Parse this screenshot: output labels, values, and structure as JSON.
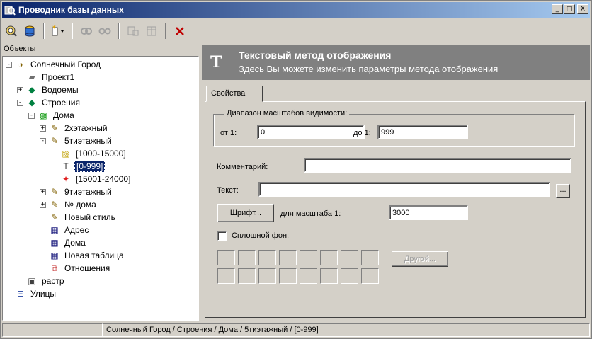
{
  "window": {
    "title": "Проводник базы данных",
    "buttons": [
      "_",
      "□",
      "X"
    ]
  },
  "toolbar": {
    "icons": [
      "database-find-icon",
      "database-open-icon",
      "new-item-icon",
      "link-icon",
      "unlink-icon",
      "properties-icon",
      "table-icon",
      "delete-icon"
    ]
  },
  "tree": {
    "header": "Объекты",
    "items": [
      {
        "label": "Солнечный Город",
        "level": 0,
        "expander": "−",
        "icon": "planet-icon",
        "iconChar": "◑",
        "iconColor": "#806000"
      },
      {
        "label": "Проект1",
        "level": 1,
        "expander": "",
        "icon": "project-icon",
        "iconChar": "▰",
        "iconColor": "#707070"
      },
      {
        "label": "Водоемы",
        "level": 1,
        "expander": "+",
        "icon": "layer-group-icon",
        "iconChar": "◆",
        "iconColor": "#008040"
      },
      {
        "label": "Строения",
        "level": 1,
        "expander": "−",
        "icon": "layer-group-icon",
        "iconChar": "◆",
        "iconColor": "#008040"
      },
      {
        "label": "Дома",
        "level": 2,
        "expander": "−",
        "icon": "layer-icon",
        "iconChar": "▩",
        "iconColor": "#20a020"
      },
      {
        "label": "2хэтажный",
        "level": 3,
        "expander": "+",
        "icon": "style-pencil-icon",
        "iconChar": "✎",
        "iconColor": "#806000"
      },
      {
        "label": "5тиэтажный",
        "level": 3,
        "expander": "−",
        "icon": "style-pencil-icon",
        "iconChar": "✎",
        "iconColor": "#806000"
      },
      {
        "label": "[1000-15000]",
        "level": 4,
        "expander": "",
        "icon": "hatch-method-icon",
        "iconChar": "▨",
        "iconColor": "#c0a000"
      },
      {
        "label": "[0-999]",
        "level": 4,
        "expander": "",
        "icon": "text-method-icon",
        "iconChar": "T",
        "iconColor": "#404040",
        "selected": true
      },
      {
        "label": "[15001-24000]",
        "level": 4,
        "expander": "",
        "icon": "symbol-method-icon",
        "iconChar": "✦",
        "iconColor": "#e02020"
      },
      {
        "label": "9тиэтажный",
        "level": 3,
        "expander": "+",
        "icon": "style-pencil-icon",
        "iconChar": "✎",
        "iconColor": "#806000"
      },
      {
        "label": "№ дома",
        "level": 3,
        "expander": "+",
        "icon": "style-pencil-icon",
        "iconChar": "✎",
        "iconColor": "#806000"
      },
      {
        "label": "Новый стиль",
        "level": 3,
        "expander": "",
        "icon": "style-pencil-icon",
        "iconChar": "✎",
        "iconColor": "#806000"
      },
      {
        "label": "Адрес",
        "level": 3,
        "expander": "",
        "icon": "table-icon",
        "iconChar": "▦",
        "iconColor": "#202080"
      },
      {
        "label": "Дома",
        "level": 3,
        "expander": "",
        "icon": "table-icon",
        "iconChar": "▦",
        "iconColor": "#202080"
      },
      {
        "label": "Новая таблица",
        "level": 3,
        "expander": "",
        "icon": "table-icon",
        "iconChar": "▦",
        "iconColor": "#202080"
      },
      {
        "label": "Отношения",
        "level": 3,
        "expander": "",
        "icon": "relations-icon",
        "iconChar": "⧉",
        "iconColor": "#c02020"
      },
      {
        "label": "растр",
        "level": 1,
        "expander": "",
        "icon": "raster-icon",
        "iconChar": "▣",
        "iconColor": "#404040"
      },
      {
        "label": "Улицы",
        "level": 0,
        "expander": "",
        "icon": "streets-icon",
        "iconChar": "⊟",
        "iconColor": "#2040a0"
      }
    ]
  },
  "header": {
    "icon": "T",
    "title": "Текстовый метод отображения",
    "subtitle": "Здесь Вы можете изменить параметры метода отображения"
  },
  "tab": {
    "label": "Свойства"
  },
  "visibility": {
    "group_title": "Диапазон масштабов видимости:",
    "from_label": "от 1:",
    "from_value": "0",
    "to_label": "до 1:",
    "to_value": "999"
  },
  "comment": {
    "label": "Комментарий:",
    "value": ""
  },
  "text": {
    "label": "Текст:",
    "value": "",
    "browse_label": "..."
  },
  "font": {
    "button_label": "Шрифт...",
    "scale_label": "для масштаба 1:",
    "scale_value": "3000"
  },
  "solid_bg": {
    "label": "Сплошной фон:",
    "checked": false
  },
  "other_button": "Другой...",
  "status": {
    "path": "Солнечный Город / Строения / Дома / 5тиэтажный / [0-999]"
  }
}
